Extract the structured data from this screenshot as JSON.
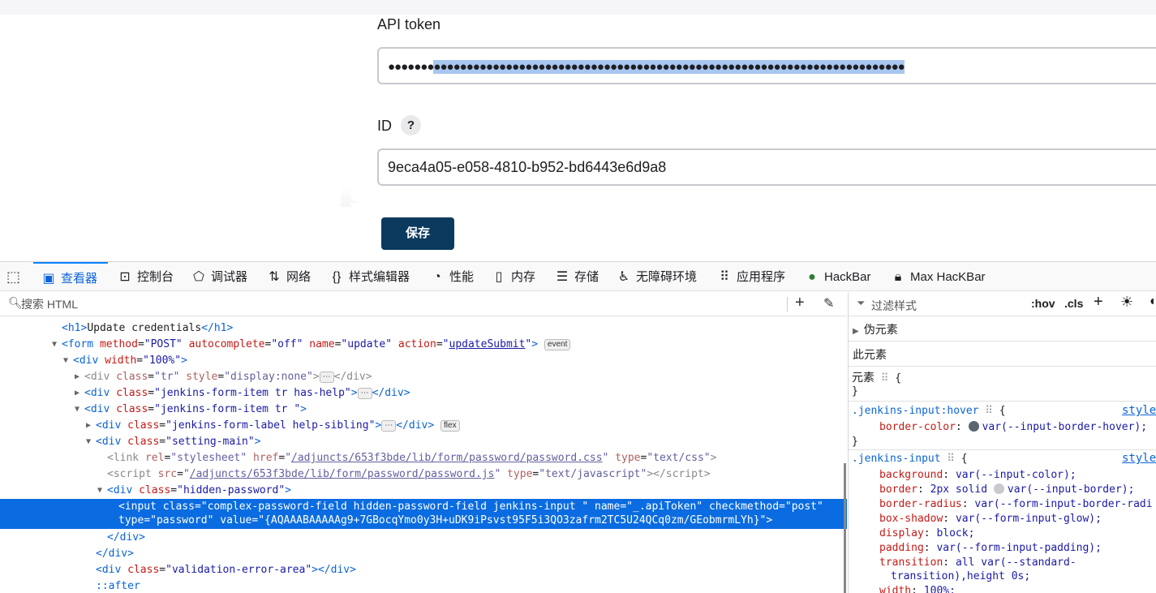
{
  "form": {
    "api_token_label": "API token",
    "api_token_dots_plain": "●●●●●●●",
    "api_token_dots_selected": "●●●●●●●●●●●●●●●●●●●●●●●●●●●●●●●●●●●●●●●●●●●●●●●●●●●●●●●●●●●●●●●●●●●●●●●●",
    "id_label": "ID",
    "help_symbol": "?",
    "id_value": "9eca4a05-e058-4810-b952-bd6443e6d9a8",
    "save_label": "保存",
    "colors": {
      "save_bg": "#0b3a5e",
      "selection": "#a8c7f0"
    }
  },
  "devtools": {
    "tabs": [
      {
        "label": "查看器",
        "icon": "inspector-icon",
        "active": true
      },
      {
        "label": "控制台",
        "icon": "console-icon"
      },
      {
        "label": "调试器",
        "icon": "debugger-icon"
      },
      {
        "label": "网络",
        "icon": "network-icon"
      },
      {
        "label": "样式编辑器",
        "icon": "style-editor-icon"
      },
      {
        "label": "性能",
        "icon": "performance-icon"
      },
      {
        "label": "内存",
        "icon": "memory-icon"
      },
      {
        "label": "存储",
        "icon": "storage-icon"
      },
      {
        "label": "无障碍环境",
        "icon": "accessibility-icon"
      },
      {
        "label": "应用程序",
        "icon": "application-icon"
      },
      {
        "label": "HackBar",
        "icon": "hackbar-icon"
      },
      {
        "label": "Max HacKBar",
        "icon": "max-hackbar-icon"
      }
    ],
    "search_placeholder": "搜索 HTML",
    "rules": {
      "filter_placeholder": "过滤样式",
      "hov": ":hov",
      "cls": ".cls",
      "pseudo_elements": "伪元素",
      "this_element": "此元素",
      "element_label": "元素",
      "open_brace": "{",
      "close_brace": "}",
      "hover_selector": ".jenkins-input",
      "hover_pseudo": ":hover",
      "hover_prop": "border-color",
      "hover_val": "var(--input-border-hover);",
      "styles_link": "styles",
      "rule2_selector": ".jenkins-input",
      "rule2": [
        {
          "prop": "background",
          "val": "var(--input-color);"
        },
        {
          "prop": "border",
          "val": "2px solid",
          "val2": "var(--input-border);"
        },
        {
          "prop": "border-radius",
          "val": "var(--form-input-border-radi"
        },
        {
          "prop": "box-shadow",
          "val": "var(--form-input-glow);"
        },
        {
          "prop": "display",
          "val": "block;"
        },
        {
          "prop": "padding",
          "val": "var(--form-input-padding);"
        },
        {
          "prop": "transition",
          "val": "all var(--standard-"
        },
        {
          "prop": "",
          "val": "transition),height 0s;"
        },
        {
          "prop": "width",
          "val": "100%;"
        }
      ]
    },
    "markup": {
      "h1_text": "Update credentials",
      "form_method": "POST",
      "form_autocomplete": "off",
      "form_name": "update",
      "form_action": "updateSubmit",
      "event_badge": "event",
      "flex_badge": "flex",
      "ellipsis": "⋯",
      "div_width": "100%",
      "tr_class": "tr",
      "tr_style": "display:none",
      "item_has_help": "jenkins-form-item tr has-help",
      "item_tr": "jenkins-form-item tr ",
      "label_class": "jenkins-form-label help-sibling",
      "setting_main": "setting-main",
      "link_rel": "stylesheet",
      "link_href": "/adjuncts/653f3bde/lib/form/password/password.css",
      "link_type": "text/css",
      "script_src": "/adjuncts/653f3bde/lib/form/password/password.js",
      "script_type": "text/javascript",
      "hidden_password": "hidden-password",
      "input_class": "complex-password-field hidden-password-field jenkins-input ",
      "input_name": "_.apiToken",
      "input_checkmethod": "post",
      "input_type": "password",
      "input_value": "{AQAAABAAAAAg9+7GBocqYmo0y3H+uDK9iPsvst95F5i3QO3zafrm2TC5U24QCq0zm/GEobmrmLYh}",
      "validation_class": "validation-error-area",
      "after_pseudo": "::after"
    }
  }
}
